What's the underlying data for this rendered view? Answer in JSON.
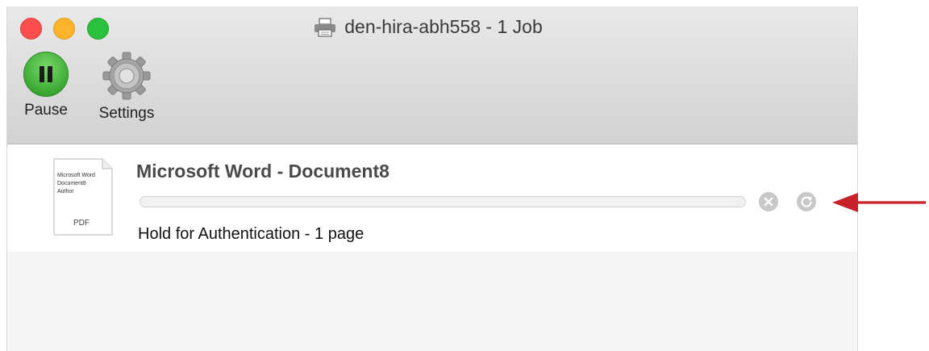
{
  "window": {
    "title": "den-hira-abh558 - 1 Job",
    "title_icon": "printer-icon"
  },
  "toolbar": {
    "pause_label": "Pause",
    "settings_label": "Settings"
  },
  "job": {
    "name": "Microsoft Word - Document8",
    "status": "Hold for Authentication - 1 page",
    "progress": 0,
    "thumbnail_lines": [
      "Microsoft Word",
      "Document8",
      "Author"
    ],
    "thumbnail_format": "PDF"
  },
  "colors": {
    "annotation_arrow": "#c8212a",
    "pause_green": "#3aa832"
  }
}
